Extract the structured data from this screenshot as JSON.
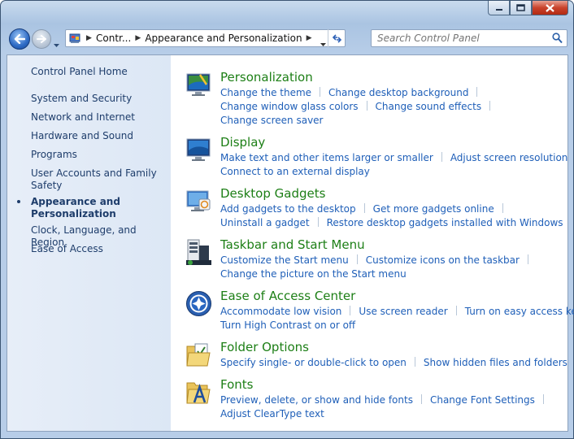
{
  "window": {
    "caption": {
      "minimize_icon": "minimize-icon",
      "maximize_icon": "maximize-icon",
      "close_icon": "close-icon"
    }
  },
  "toolbar": {
    "breadcrumbs": [
      "Contr...",
      "Appearance and Personalization"
    ],
    "search_placeholder": "Search Control Panel"
  },
  "sidebar": {
    "home": "Control Panel Home",
    "items": [
      "System and Security",
      "Network and Internet",
      "Hardware and Sound",
      "Programs",
      "User Accounts and Family Safety",
      "Appearance and Personalization",
      "Clock, Language, and Region",
      "Ease of Access"
    ],
    "active_index": 5
  },
  "categories": [
    {
      "title": "Personalization",
      "icon": "personalization-icon",
      "lines": [
        [
          "Change the theme",
          "Change desktop background"
        ],
        [
          "Change window glass colors",
          "Change sound effects"
        ],
        [
          "Change screen saver"
        ]
      ]
    },
    {
      "title": "Display",
      "icon": "display-icon",
      "lines": [
        [
          "Make text and other items larger or smaller",
          "Adjust screen resolution"
        ],
        [
          "Connect to an external display"
        ]
      ]
    },
    {
      "title": "Desktop Gadgets",
      "icon": "desktop-gadgets-icon",
      "lines": [
        [
          "Add gadgets to the desktop",
          "Get more gadgets online"
        ],
        [
          "Uninstall a gadget",
          "Restore desktop gadgets installed with Windows"
        ]
      ]
    },
    {
      "title": "Taskbar and Start Menu",
      "icon": "taskbar-icon",
      "lines": [
        [
          "Customize the Start menu",
          "Customize icons on the taskbar"
        ],
        [
          "Change the picture on the Start menu"
        ]
      ]
    },
    {
      "title": "Ease of Access Center",
      "icon": "ease-of-access-icon",
      "lines": [
        [
          "Accommodate low vision",
          "Use screen reader",
          "Turn on easy access keys"
        ],
        [
          "Turn High Contrast on or off"
        ]
      ]
    },
    {
      "title": "Folder Options",
      "icon": "folder-options-icon",
      "lines": [
        [
          "Specify single- or double-click to open",
          "Show hidden files and folders"
        ]
      ]
    },
    {
      "title": "Fonts",
      "icon": "fonts-icon",
      "lines": [
        [
          "Preview, delete, or show and hide fonts",
          "Change Font Settings"
        ],
        [
          "Adjust ClearType text"
        ]
      ]
    }
  ],
  "colors": {
    "link": "#1f5fb8",
    "category_title": "#1d7f16",
    "sidebar_text": "#1e3d6b"
  }
}
